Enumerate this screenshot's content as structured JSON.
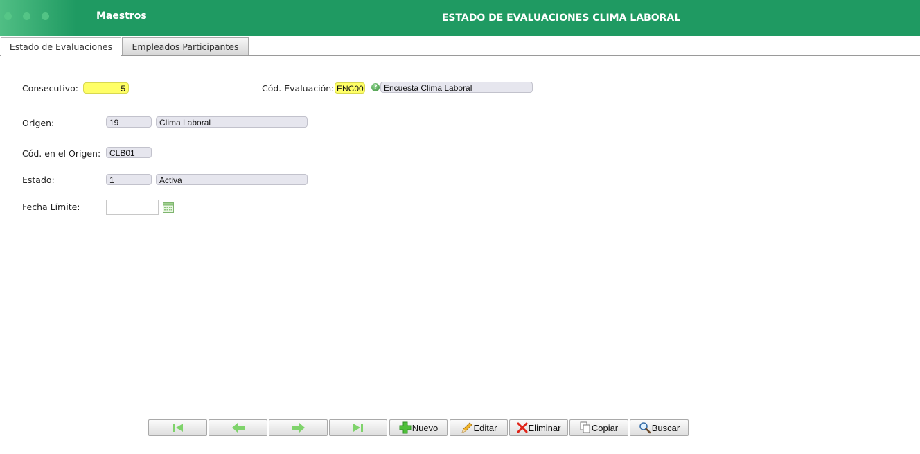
{
  "header": {
    "module_title": "Maestros",
    "page_title": "ESTADO DE EVALUACIONES CLIMA LABORAL",
    "color": "#1f9a62"
  },
  "tabs": [
    {
      "label": "Estado de Evaluaciones",
      "active": true
    },
    {
      "label": "Empleados Participantes",
      "active": false
    }
  ],
  "form": {
    "consecutivo": {
      "label": "Consecutivo:",
      "value": "5"
    },
    "cod_evaluacion": {
      "label": "Cód. Evaluación:",
      "code": "ENC00",
      "description": "Encuesta Clima Laboral"
    },
    "origen": {
      "label": "Origen:",
      "code": "19",
      "description": "Clima Laboral"
    },
    "cod_origen": {
      "label": "Cód. en el Origen:",
      "value": "CLB01"
    },
    "estado": {
      "label": "Estado:",
      "code": "1",
      "description": "Activa"
    },
    "fecha_limite": {
      "label": "Fecha Límite:",
      "value": ""
    }
  },
  "toolbar": {
    "nuevo": "Nuevo",
    "editar": "Editar",
    "eliminar": "Eliminar",
    "copiar": "Copiar",
    "buscar": "Buscar"
  },
  "icons": {
    "first": "first-record-icon",
    "prev": "previous-record-icon",
    "next": "next-record-icon",
    "last": "last-record-icon",
    "add": "plus-icon",
    "edit": "pencil-icon",
    "delete": "x-icon",
    "copy": "copy-icon",
    "search": "magnifier-icon",
    "help": "help-icon",
    "calendar": "calendar-icon"
  },
  "colors": {
    "highlight_field": "#ffff66",
    "readonly_field": "#e6e6ee",
    "nav_arrow": "#7fd36b"
  }
}
